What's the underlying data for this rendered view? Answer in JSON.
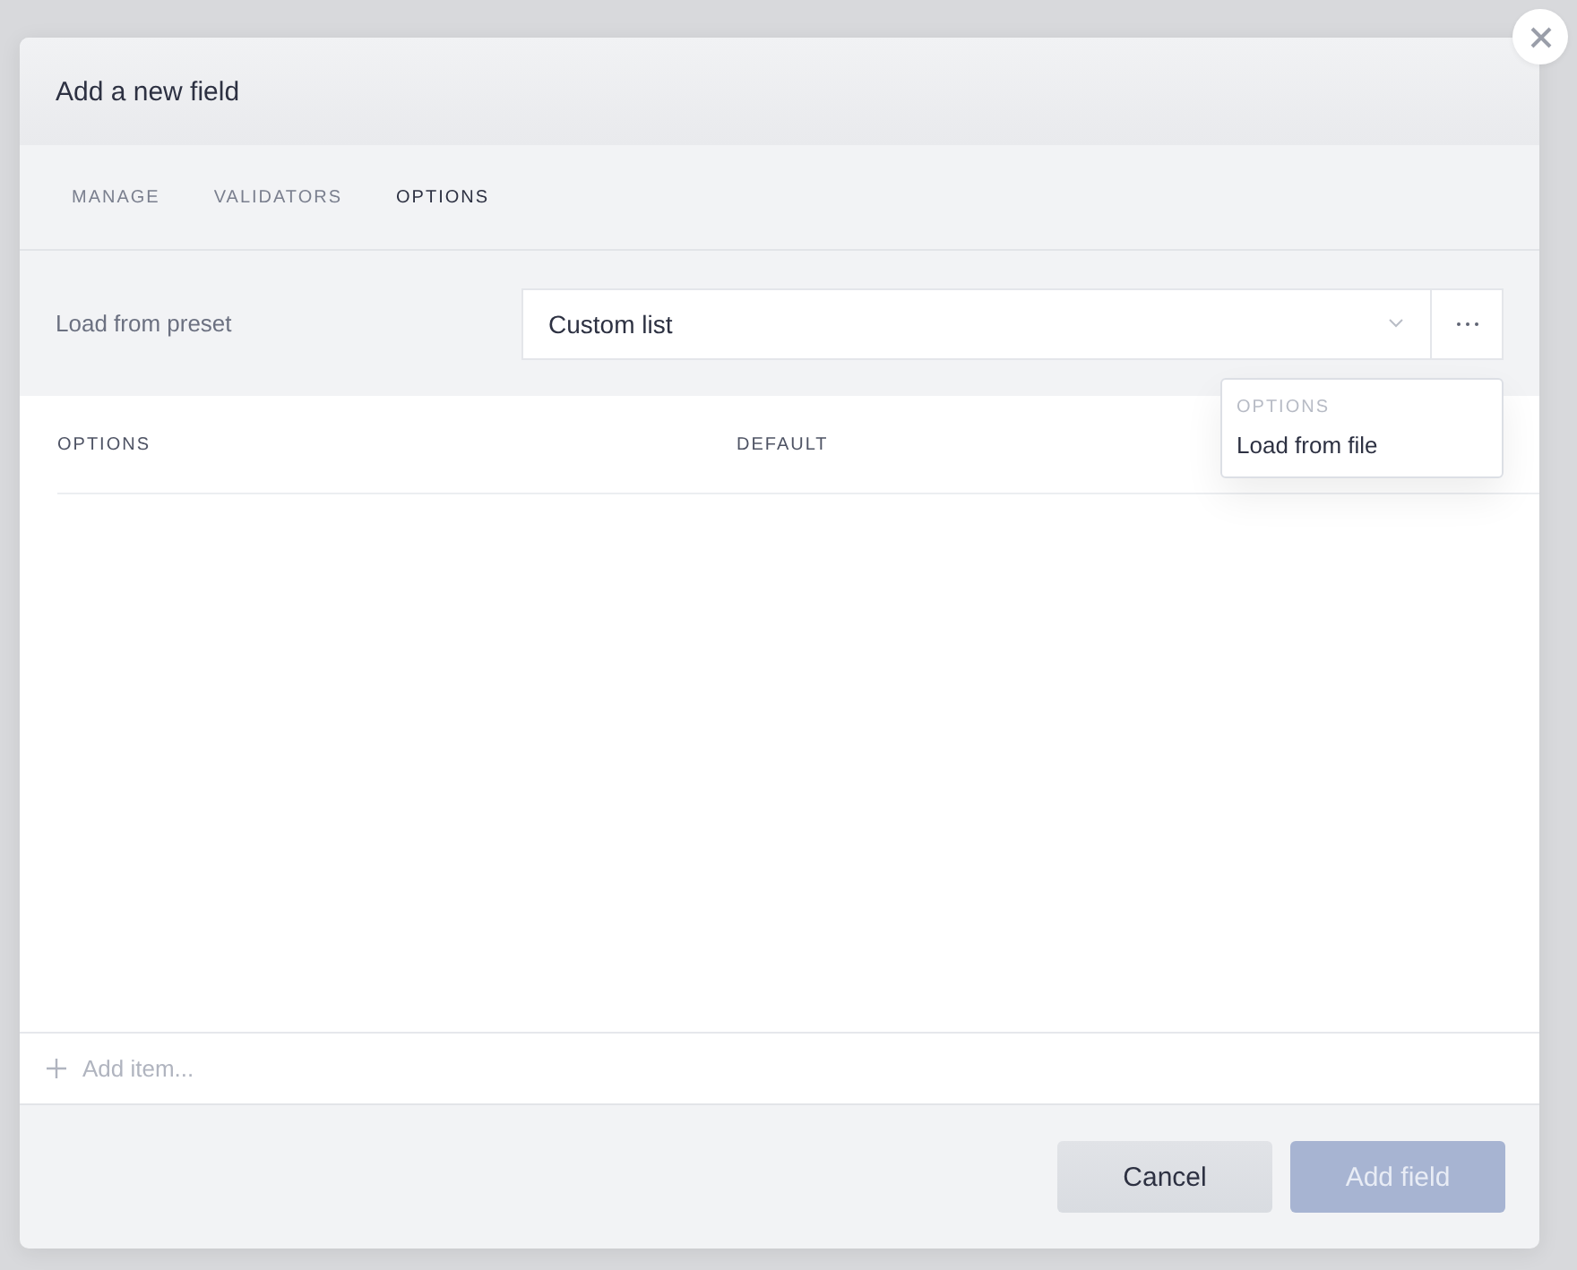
{
  "dialog": {
    "title": "Add a new field"
  },
  "tabs": [
    {
      "label": "MANAGE",
      "selected": false
    },
    {
      "label": "VALIDATORS",
      "selected": false
    },
    {
      "label": "OPTIONS",
      "selected": true
    }
  ],
  "preset": {
    "label": "Load from preset",
    "value": "Custom list"
  },
  "menu": {
    "header": "OPTIONS",
    "items": [
      "Load from file"
    ]
  },
  "table": {
    "columns": [
      "OPTIONS",
      "DEFAULT"
    ]
  },
  "add_item": {
    "placeholder": "Add item..."
  },
  "buttons": [
    {
      "label": "Cancel",
      "kind": "secondary",
      "disabled": false
    },
    {
      "label": "Add field",
      "kind": "primary",
      "disabled": true
    }
  ]
}
